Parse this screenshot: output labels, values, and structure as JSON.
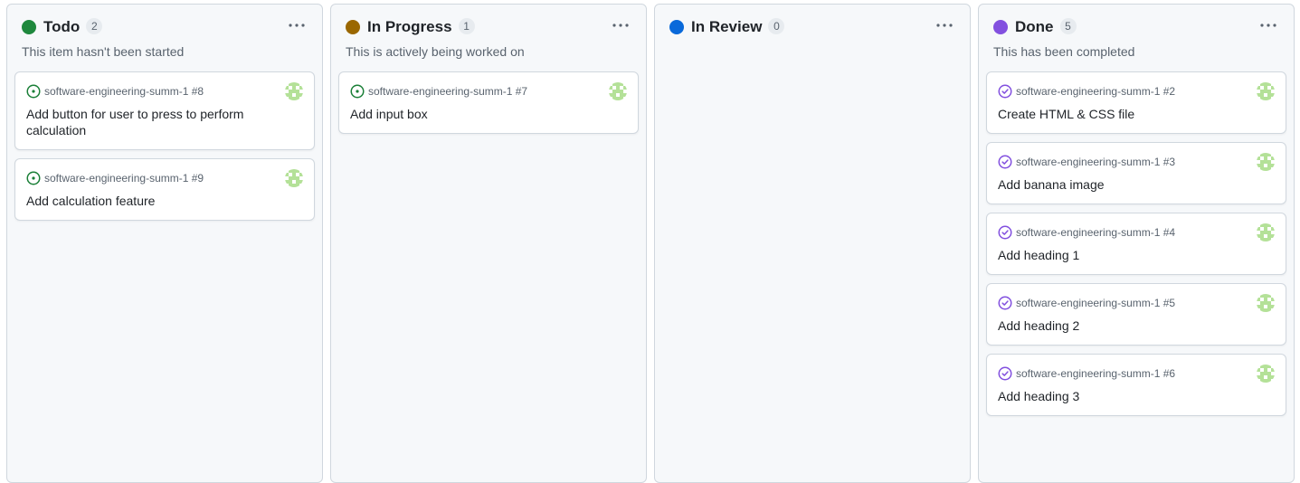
{
  "colors": {
    "open_issue": "#1a7f37",
    "closed_issue": "#8250df",
    "avatar_bg": "#ffffff",
    "avatar_fg": "#b4e198"
  },
  "columns": [
    {
      "title": "Todo",
      "count": "2",
      "color": "#1f883d",
      "description": "This item hasn't been started",
      "cards": [
        {
          "repo": "software-engineering-summ-1",
          "number": "#8",
          "title": "Add button for user to press to perform calculation",
          "state": "open"
        },
        {
          "repo": "software-engineering-summ-1",
          "number": "#9",
          "title": "Add calculation feature",
          "state": "open"
        }
      ]
    },
    {
      "title": "In Progress",
      "count": "1",
      "color": "#9a6700",
      "description": "This is actively being worked on",
      "cards": [
        {
          "repo": "software-engineering-summ-1",
          "number": "#7",
          "title": "Add input box",
          "state": "open"
        }
      ]
    },
    {
      "title": "In Review",
      "count": "0",
      "color": "#0969da",
      "description": "",
      "cards": []
    },
    {
      "title": "Done",
      "count": "5",
      "color": "#8250df",
      "description": "This has been completed",
      "cards": [
        {
          "repo": "software-engineering-summ-1",
          "number": "#2",
          "title": "Create HTML & CSS file",
          "state": "closed"
        },
        {
          "repo": "software-engineering-summ-1",
          "number": "#3",
          "title": "Add banana image",
          "state": "closed"
        },
        {
          "repo": "software-engineering-summ-1",
          "number": "#4",
          "title": "Add heading 1",
          "state": "closed"
        },
        {
          "repo": "software-engineering-summ-1",
          "number": "#5",
          "title": "Add heading 2",
          "state": "closed"
        },
        {
          "repo": "software-engineering-summ-1",
          "number": "#6",
          "title": "Add heading 3",
          "state": "closed"
        }
      ]
    }
  ]
}
